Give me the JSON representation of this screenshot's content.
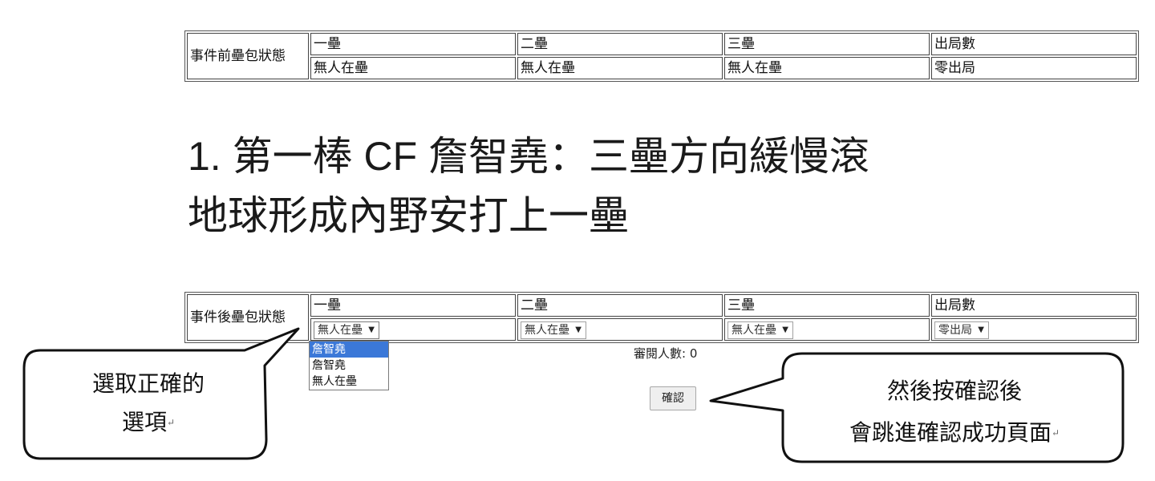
{
  "before_table": {
    "row_label": "事件前壘包狀態",
    "headers": [
      "一壘",
      "二壘",
      "三壘",
      "出局數"
    ],
    "values": [
      "無人在壘",
      "無人在壘",
      "無人在壘",
      "零出局"
    ]
  },
  "heading": {
    "line1": "1. 第一棒 CF 詹智堯：三壘方向緩慢滾",
    "line2": "地球形成內野安打上一壘"
  },
  "after_table": {
    "row_label": "事件後壘包狀態",
    "headers": [
      "一壘",
      "二壘",
      "三壘",
      "出局數"
    ],
    "selects": [
      "無人在壘",
      "無人在壘",
      "無人在壘",
      "零出局"
    ]
  },
  "dropdown": {
    "options": [
      "詹智堯",
      "詹智堯",
      "無人在壘"
    ],
    "highlighted_index": 0
  },
  "viewer_count": "審閱人數: 0",
  "confirm_label": "確認",
  "callout_left": {
    "line1": "選取正確的",
    "line2": "選項",
    "mark": "↵"
  },
  "callout_right": {
    "line1": "然後按確認後",
    "line2": "會跳進確認成功頁面",
    "mark": "↵"
  },
  "icons": {
    "select_arrow": "triangle-down-icon",
    "return_mark": "return-mark-icon"
  }
}
